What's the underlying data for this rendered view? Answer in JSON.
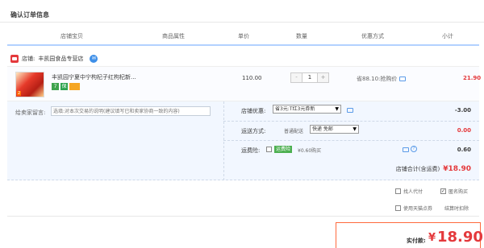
{
  "page_title": "确认订单信息",
  "columns": [
    "店铺宝贝",
    "商品属性",
    "单价",
    "数量",
    "优惠方式",
    "小计"
  ],
  "shop": {
    "label": "店铺:",
    "name": "丰凯园食品专营店",
    "chat_icon": "ww-icon"
  },
  "item": {
    "title": "丰凯园宁夏中宁枸杞子红枸杞新...",
    "thumb_badge": "2",
    "tags": [
      "7",
      "保",
      ""
    ],
    "price": "110.00",
    "quantity": "1",
    "minus_label": "-",
    "plus_label": "+",
    "promo": "省88.10:抢购价",
    "subtotal": "21.90"
  },
  "message": {
    "label": "给卖家留言:",
    "placeholder": "选填:对本次交易的说明(建议填写已和卖家协商一致的内容)"
  },
  "discount": {
    "label": "店铺优惠:",
    "selected": "省3元:T红3元券新",
    "amount": "-3.00"
  },
  "shipping": {
    "label": "运送方式:",
    "method": "普通配送",
    "selected": "快递 免邮",
    "amount": "0.00"
  },
  "insurance": {
    "label": "运费险:",
    "tag": "运费险",
    "text": "¥0.60购买",
    "amount": "0.60"
  },
  "store_total": {
    "label": "店铺合计(含运费)",
    "value": "¥18.90"
  },
  "options": {
    "proxy_pay": "找人代付",
    "anonymous": "匿名购买",
    "tmall_points": "使用天猫点券",
    "points_note": "结算时扣除"
  },
  "payment": {
    "label": "实付款:",
    "currency": "¥",
    "amount": "18.90"
  },
  "colors": {
    "accent": "#e4393c",
    "header_line": "#b2d1ff",
    "panel_bg": "#f2f7ff",
    "pay_border": "#ff6a3d"
  }
}
